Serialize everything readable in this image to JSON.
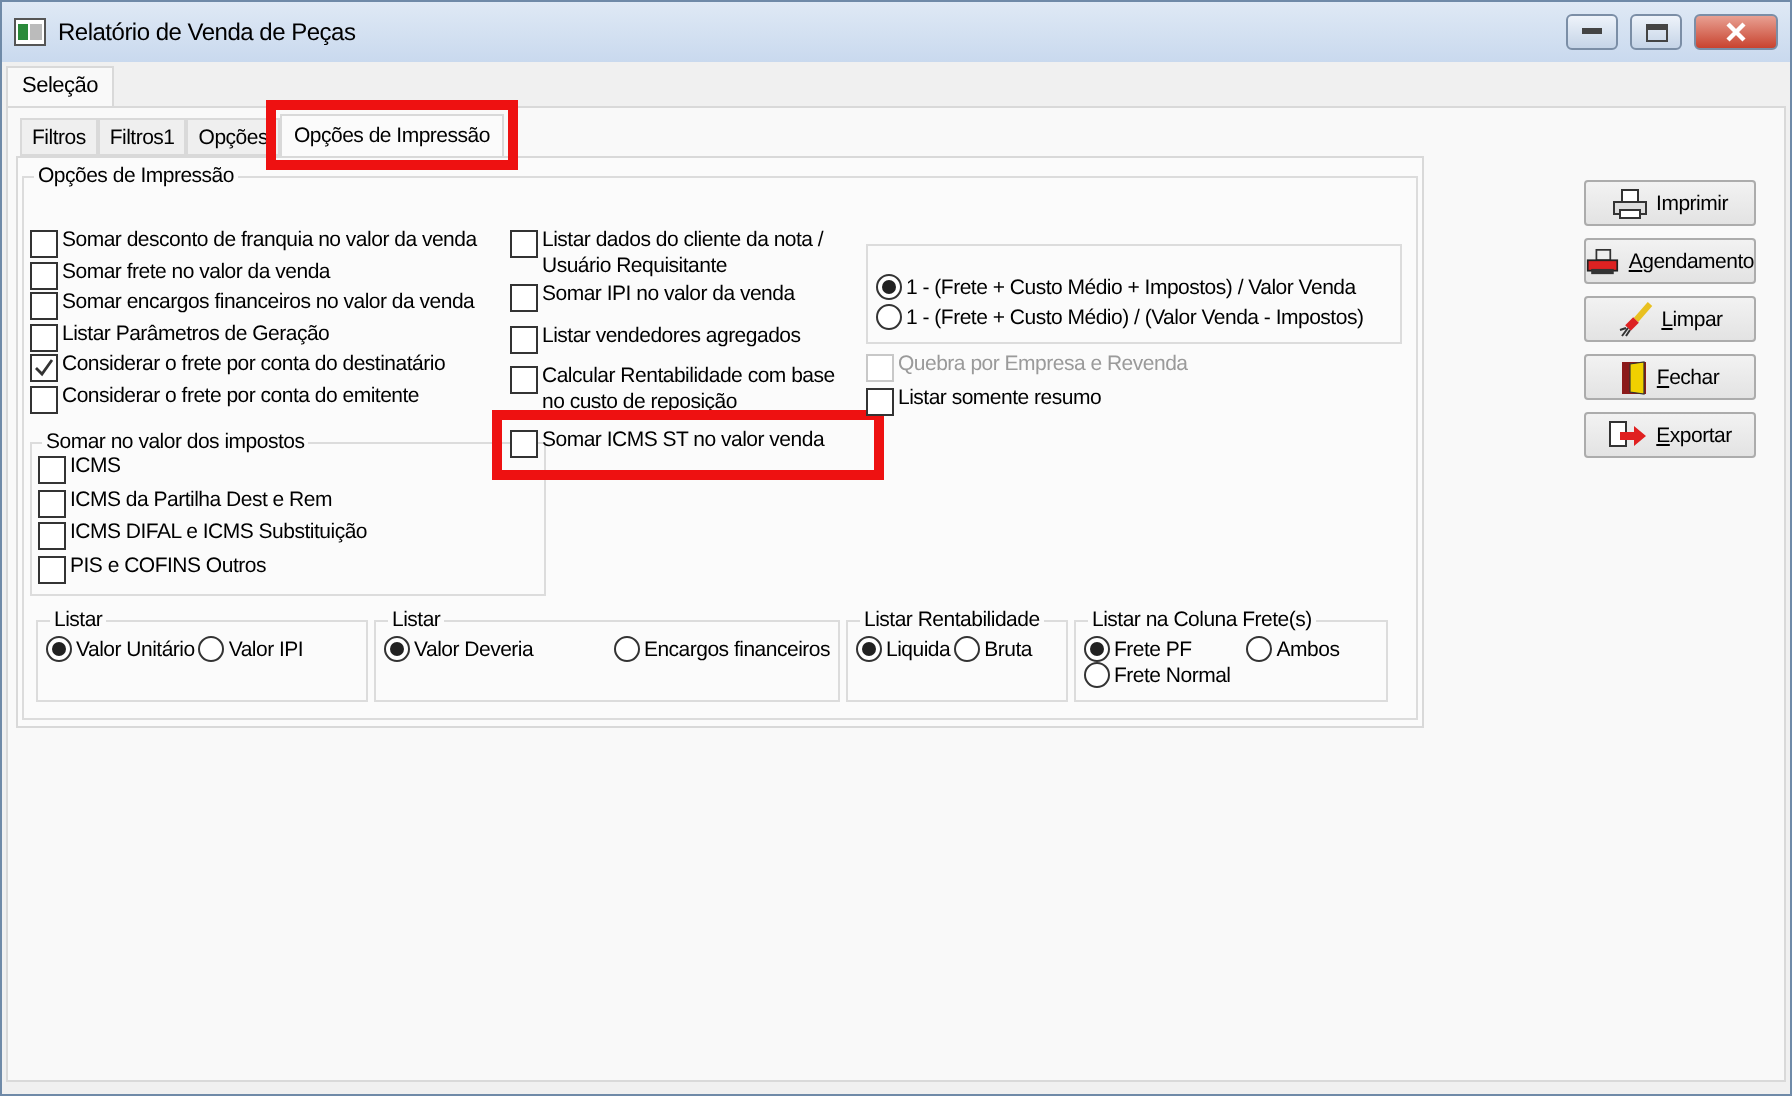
{
  "window": {
    "title": "Relatório de Venda de Peças"
  },
  "outer_tabs": [
    {
      "label": "Seleção"
    }
  ],
  "tabs": [
    {
      "label": "Filtros",
      "selected": false,
      "highlighted": false
    },
    {
      "label": "Filtros1",
      "selected": false,
      "highlighted": false
    },
    {
      "label": "Opções",
      "selected": false,
      "highlighted": false
    },
    {
      "label": "Opções de Impressão",
      "selected": true,
      "highlighted": true
    }
  ],
  "group": {
    "title": "Opções de Impressão"
  },
  "left_options": [
    {
      "label": "Somar desconto de franquia no valor da venda",
      "checked": false
    },
    {
      "label": "Somar frete no valor da venda",
      "checked": false
    },
    {
      "label": "Somar encargos financeiros no valor da venda",
      "checked": false
    },
    {
      "label": "Listar Parâmetros de Geração",
      "checked": false
    },
    {
      "label": "Considerar o frete por conta do destinatário",
      "checked": true
    },
    {
      "label": "Considerar o frete por conta do emitente",
      "checked": false
    }
  ],
  "middle_options": [
    {
      "label": "Listar dados do cliente da nota / Usuário Requisitante",
      "checked": false,
      "highlighted": false
    },
    {
      "label": "Somar IPI no valor da venda",
      "checked": false,
      "highlighted": false
    },
    {
      "label": "Listar vendedores agregados",
      "checked": false,
      "highlighted": false
    },
    {
      "label": "Calcular Rentabilidade com base no custo de reposição",
      "checked": false,
      "highlighted": false
    },
    {
      "label": "Somar ICMS ST no valor venda",
      "checked": false,
      "highlighted": true
    }
  ],
  "formula_options": [
    {
      "label": "1 - (Frete + Custo Médio + Impostos) / Valor Venda",
      "selected": true
    },
    {
      "label": "1 - (Frete + Custo Médio) / (Valor Venda - Impostos)",
      "selected": false
    }
  ],
  "right_options": [
    {
      "label": "Quebra por Empresa e Revenda",
      "checked": false,
      "disabled": true
    },
    {
      "label": "Listar somente resumo",
      "checked": false,
      "disabled": false
    }
  ],
  "impostos": {
    "title": "Somar no valor dos impostos",
    "options": [
      {
        "label": "ICMS",
        "checked": false
      },
      {
        "label": "ICMS da Partilha Dest e Rem",
        "checked": false
      },
      {
        "label": "ICMS DIFAL e ICMS Substituição",
        "checked": false
      },
      {
        "label": "PIS e COFINS Outros",
        "checked": false
      }
    ]
  },
  "radio_groups": [
    {
      "title": "Listar",
      "kind": "row",
      "options": [
        {
          "label": "Valor Unitário",
          "selected": true
        },
        {
          "label": "Valor IPI",
          "selected": false
        }
      ]
    },
    {
      "title": "Listar",
      "kind": "spread",
      "options": [
        {
          "label": "Valor Deveria",
          "selected": true
        },
        {
          "label": "Encargos financeiros",
          "selected": false
        }
      ]
    },
    {
      "title": "Listar Rentabilidade",
      "kind": "row",
      "options": [
        {
          "label": "Liquida",
          "selected": true
        },
        {
          "label": "Bruta",
          "selected": false
        }
      ]
    },
    {
      "title": "Listar na Coluna Frete(s)",
      "kind": "grid",
      "options": [
        {
          "label": "Frete PF",
          "selected": true
        },
        {
          "label": "Ambos",
          "selected": false
        },
        {
          "label": "Frete Normal",
          "selected": false
        }
      ]
    }
  ],
  "buttons": [
    {
      "label": "Imprimir",
      "kind": "print",
      "mnemonic": false
    },
    {
      "label": "Agendamento",
      "kind": "schedule",
      "mnemonic": true
    },
    {
      "label": "Limpar",
      "kind": "clear",
      "mnemonic": true
    },
    {
      "label": "Fechar",
      "kind": "close",
      "mnemonic": true
    },
    {
      "label": "Exportar",
      "kind": "export",
      "mnemonic": true
    }
  ]
}
